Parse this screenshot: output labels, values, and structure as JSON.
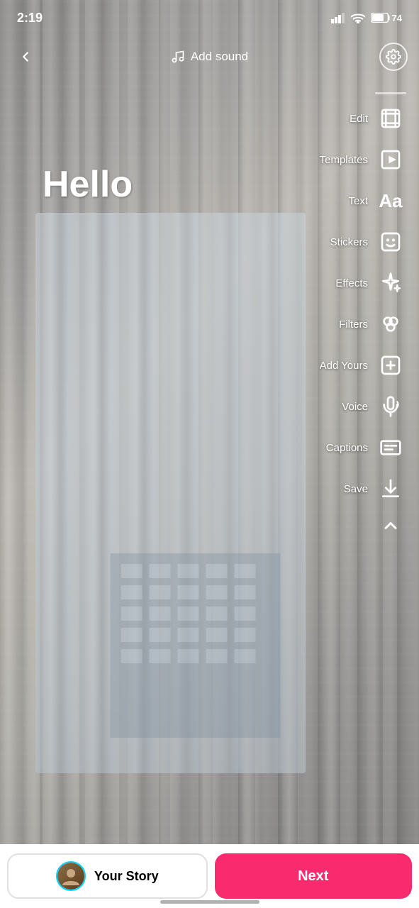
{
  "statusBar": {
    "time": "2:19",
    "battery": "74"
  },
  "topBar": {
    "addSoundLabel": "Add sound",
    "backIcon": "chevron-left",
    "settingsIcon": "gear"
  },
  "mainContent": {
    "helloText": "Hello"
  },
  "toolbar": {
    "divider": "",
    "items": [
      {
        "id": "edit",
        "label": "Edit",
        "icon": "edit-icon"
      },
      {
        "id": "templates",
        "label": "Templates",
        "icon": "templates-icon"
      },
      {
        "id": "text",
        "label": "Text",
        "icon": "text-icon"
      },
      {
        "id": "stickers",
        "label": "Stickers",
        "icon": "stickers-icon"
      },
      {
        "id": "effects",
        "label": "Effects",
        "icon": "effects-icon"
      },
      {
        "id": "filters",
        "label": "Filters",
        "icon": "filters-icon"
      },
      {
        "id": "add-yours",
        "label": "Add Yours",
        "icon": "add-yours-icon"
      },
      {
        "id": "voice",
        "label": "Voice",
        "icon": "voice-icon"
      },
      {
        "id": "captions",
        "label": "Captions",
        "icon": "captions-icon"
      },
      {
        "id": "save",
        "label": "Save",
        "icon": "save-icon"
      }
    ],
    "collapseIcon": "chevron-up"
  },
  "bottomBar": {
    "yourStoryLabel": "Your Story",
    "nextLabel": "Next"
  }
}
